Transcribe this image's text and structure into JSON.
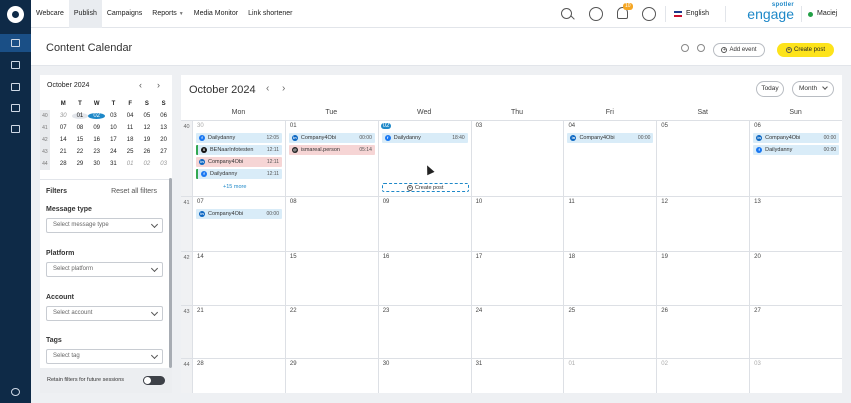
{
  "nav": {
    "items": [
      {
        "label": "Webcare",
        "active": false,
        "caret": false
      },
      {
        "label": "Publish",
        "active": true,
        "caret": false
      },
      {
        "label": "Campaigns",
        "active": false,
        "caret": false
      },
      {
        "label": "Reports",
        "active": false,
        "caret": true
      },
      {
        "label": "Media Monitor",
        "active": false,
        "caret": false
      },
      {
        "label": "Link shortener",
        "active": false,
        "caret": false
      }
    ],
    "notifications_badge": "10",
    "language": "English",
    "brand_top": "spotler",
    "brand_bottom": "engage",
    "user": "Maciej",
    "status_color": "#22a046"
  },
  "header": {
    "title": "Content Calendar",
    "add_event_label": "Add event",
    "create_post_label": "Create post",
    "accent": "#fde31b"
  },
  "mini_calendar": {
    "month_label": "October 2024",
    "day_headers": [
      "M",
      "T",
      "W",
      "T",
      "F",
      "S",
      "S"
    ],
    "weeks": [
      {
        "week": "40",
        "days": [
          "30",
          "01",
          "02",
          "03",
          "04",
          "05",
          "06"
        ]
      },
      {
        "week": "41",
        "days": [
          "07",
          "08",
          "09",
          "10",
          "11",
          "12",
          "13"
        ]
      },
      {
        "week": "42",
        "days": [
          "14",
          "15",
          "16",
          "17",
          "18",
          "19",
          "20"
        ]
      },
      {
        "week": "43",
        "days": [
          "21",
          "22",
          "23",
          "24",
          "25",
          "26",
          "27"
        ]
      },
      {
        "week": "44",
        "days": [
          "28",
          "29",
          "30",
          "31",
          "01",
          "02",
          "03"
        ]
      }
    ]
  },
  "filters": {
    "title": "Filters",
    "reset_label": "Reset all filters",
    "message_type": {
      "label": "Message type",
      "placeholder": "Select message type"
    },
    "platform": {
      "label": "Platform",
      "placeholder": "Select platform"
    },
    "account": {
      "label": "Account",
      "placeholder": "Select account"
    },
    "tags": {
      "label": "Tags",
      "placeholder": "Select tag"
    },
    "retain_label": "Retain filters for future sessions"
  },
  "calendar": {
    "title": "October 2024",
    "today_label": "Today",
    "view_label": "Month",
    "weekdays": [
      "Mon",
      "Tue",
      "Wed",
      "Thu",
      "Fri",
      "Sat",
      "Sun"
    ],
    "weeks": [
      {
        "week": "40",
        "days": [
          "30",
          "01",
          "02",
          "03",
          "04",
          "05",
          "06"
        ]
      },
      {
        "week": "41",
        "days": [
          "07",
          "08",
          "09",
          "10",
          "11",
          "12",
          "13"
        ]
      },
      {
        "week": "42",
        "days": [
          "14",
          "15",
          "16",
          "17",
          "18",
          "19",
          "20"
        ]
      },
      {
        "week": "43",
        "days": [
          "21",
          "22",
          "23",
          "24",
          "25",
          "26",
          "27"
        ]
      },
      {
        "week": "44",
        "days": [
          "28",
          "29",
          "30",
          "31",
          "01",
          "02",
          "03"
        ]
      }
    ],
    "posts": [
      {
        "week": 0,
        "day": 0,
        "slot": 0,
        "name": "Dailydanny",
        "time": "12:05",
        "network": "facebook",
        "style": "blue"
      },
      {
        "week": 0,
        "day": 0,
        "slot": 1,
        "name": "BENaarInfotesten",
        "time": "12:11",
        "network": "x",
        "style": "blue-green"
      },
      {
        "week": 0,
        "day": 0,
        "slot": 2,
        "name": "Company4Obi",
        "time": "12:11",
        "network": "linkedin",
        "style": "red"
      },
      {
        "week": 0,
        "day": 0,
        "slot": 3,
        "name": "Dailydanny",
        "time": "12:11",
        "network": "facebook",
        "style": "blue-green"
      },
      {
        "week": 0,
        "day": 1,
        "slot": 0,
        "name": "Company4Obi",
        "time": "00:00",
        "network": "linkedin",
        "style": "blue"
      },
      {
        "week": 0,
        "day": 1,
        "slot": 1,
        "name": "ismareal.person",
        "time": "05:14",
        "network": "threads",
        "style": "red"
      },
      {
        "week": 0,
        "day": 2,
        "slot": 0,
        "name": "Dailydanny",
        "time": "18:40",
        "network": "facebook",
        "style": "blue"
      },
      {
        "week": 0,
        "day": 4,
        "slot": 0,
        "name": "Company4Obi",
        "time": "00:00",
        "network": "linkedin",
        "style": "blue"
      },
      {
        "week": 0,
        "day": 6,
        "slot": 0,
        "name": "Company4Obi",
        "time": "00:00",
        "network": "linkedin",
        "style": "blue"
      },
      {
        "week": 0,
        "day": 6,
        "slot": 1,
        "name": "Dailydanny",
        "time": "00:00",
        "network": "facebook",
        "style": "blue"
      },
      {
        "week": 1,
        "day": 0,
        "slot": 0,
        "name": "Company4Obi",
        "time": "00:00",
        "network": "linkedin",
        "style": "blue"
      }
    ],
    "more_label": "+15 more",
    "create_post_inline": "Create post",
    "colors": {
      "facebook": "#1877f2",
      "linkedin": "#0a66c2",
      "x": "#111111",
      "threads": "#222222"
    }
  }
}
